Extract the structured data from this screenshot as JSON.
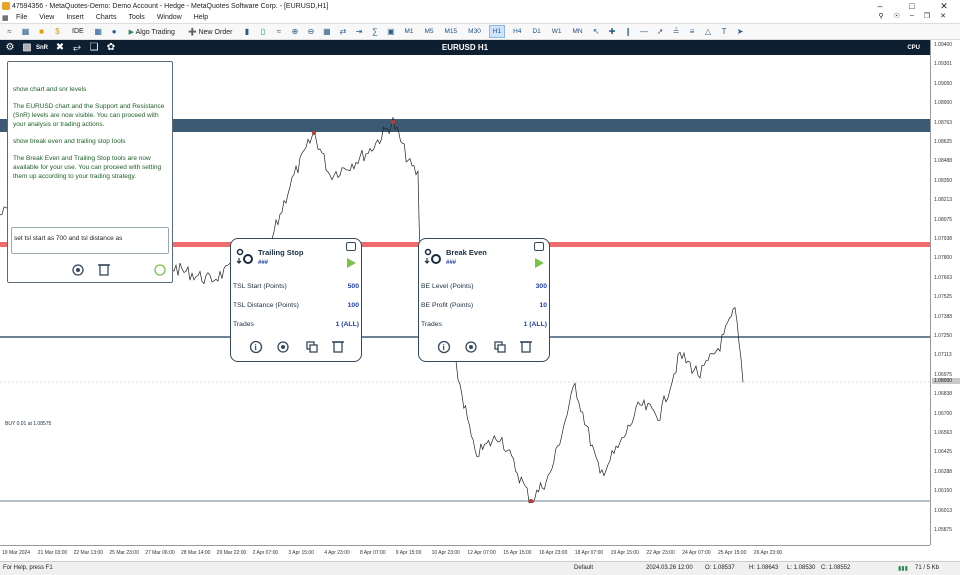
{
  "window": {
    "title": "47594356 - MetaQuotes-Demo: Demo Account - Hedge - MetaQuotes Software Corp. - [EURUSD,H1]"
  },
  "menu": {
    "items": [
      "File",
      "View",
      "Insert",
      "Charts",
      "Tools",
      "Window",
      "Help"
    ]
  },
  "toolbar": {
    "ide_label": "IDE",
    "algo_trading_label": "Algo Trading",
    "new_order_label": "New Order",
    "timeframes": [
      "M1",
      "M5",
      "M15",
      "M30",
      "H1",
      "H4",
      "D1",
      "W1",
      "MN"
    ],
    "active_timeframe": "H1"
  },
  "chart": {
    "name": "EURUSD H1",
    "cpu_label": "CPU",
    "snr_label": "SnR",
    "buy_label": "BUY 0.01 at 1.08575",
    "current_price": "1.08000",
    "price_labels": [
      "1.09400",
      "1.09301",
      "1.09050",
      "1.08900",
      "1.08763",
      "1.08625",
      "1.08488",
      "1.08350",
      "1.08213",
      "1.08075",
      "1.07938",
      "1.07800",
      "1.07663",
      "1.07525",
      "1.07388",
      "1.07250",
      "1.07113",
      "1.06975",
      "1.06838",
      "1.06700",
      "1.06563",
      "1.06425",
      "1.06288",
      "1.06150",
      "1.06013",
      "1.05875"
    ],
    "time_labels": [
      "19 Mar 2024",
      "21 Mar 03:00",
      "22 Mar 13:00",
      "25 Mar 23:00",
      "27 Mar 06:00",
      "28 Mar 14:00",
      "29 Mar 22:00",
      "2 Apr 07:00",
      "3 Apr 15:00",
      "4 Apr 23:00",
      "8 Apr 07:00",
      "9 Apr 15:00",
      "10 Apr 23:00",
      "12 Apr 07:00",
      "15 Apr 15:00",
      "16 Apr 23:00",
      "18 Apr 07:00",
      "19 Apr 15:00",
      "22 Apr 23:00",
      "24 Apr 07:00",
      "25 Apr 15:00",
      "26 Apr 23:00"
    ]
  },
  "chat": {
    "messages": [
      {
        "role": "user",
        "text": "show chart and snr levels"
      },
      {
        "role": "bot",
        "text": "The EURUSD chart and the Support and Resistance (SnR) levels are now visible. You can proceed with your analysis or trading actions."
      },
      {
        "role": "user",
        "text": "show break even and trailing stop tools"
      },
      {
        "role": "bot",
        "text": "The Break Even and Trailing Stop tools are now available for your use. You can proceed with setting them up according to your trading strategy."
      }
    ],
    "input_value": "set tsl start as 700 and tsl distance as"
  },
  "trailing_stop": {
    "title": "Trailing Stop",
    "subtitle": "###",
    "rows": [
      {
        "label": "TSL Start (Points)",
        "value": "500"
      },
      {
        "label": "TSL Distance (Points)",
        "value": "100"
      },
      {
        "label": "Trades",
        "value": "1 (ALL)"
      }
    ]
  },
  "break_even": {
    "title": "Break Even",
    "subtitle": "###",
    "rows": [
      {
        "label": "BE Level (Points)",
        "value": "300"
      },
      {
        "label": "BE Profit (Points)",
        "value": "10"
      },
      {
        "label": "Trades",
        "value": "1 (ALL)"
      }
    ]
  },
  "status": {
    "help": "For Help, press F1",
    "profile": "Default",
    "datetime": "2024.03.26 12:00",
    "open": "O: 1.08537",
    "high": "H: 1.08643",
    "low": "L: 1.08530",
    "close": "C: 1.08552",
    "traffic": "71 / 5 Kb"
  },
  "colors": {
    "header_bg": "#0d1f30",
    "resistance_band": "#3d5a75",
    "support_band": "#f06b6b",
    "panel_border": "#34495e",
    "value_blue": "#1f3fa8",
    "chat_green": "#1c5f27"
  }
}
